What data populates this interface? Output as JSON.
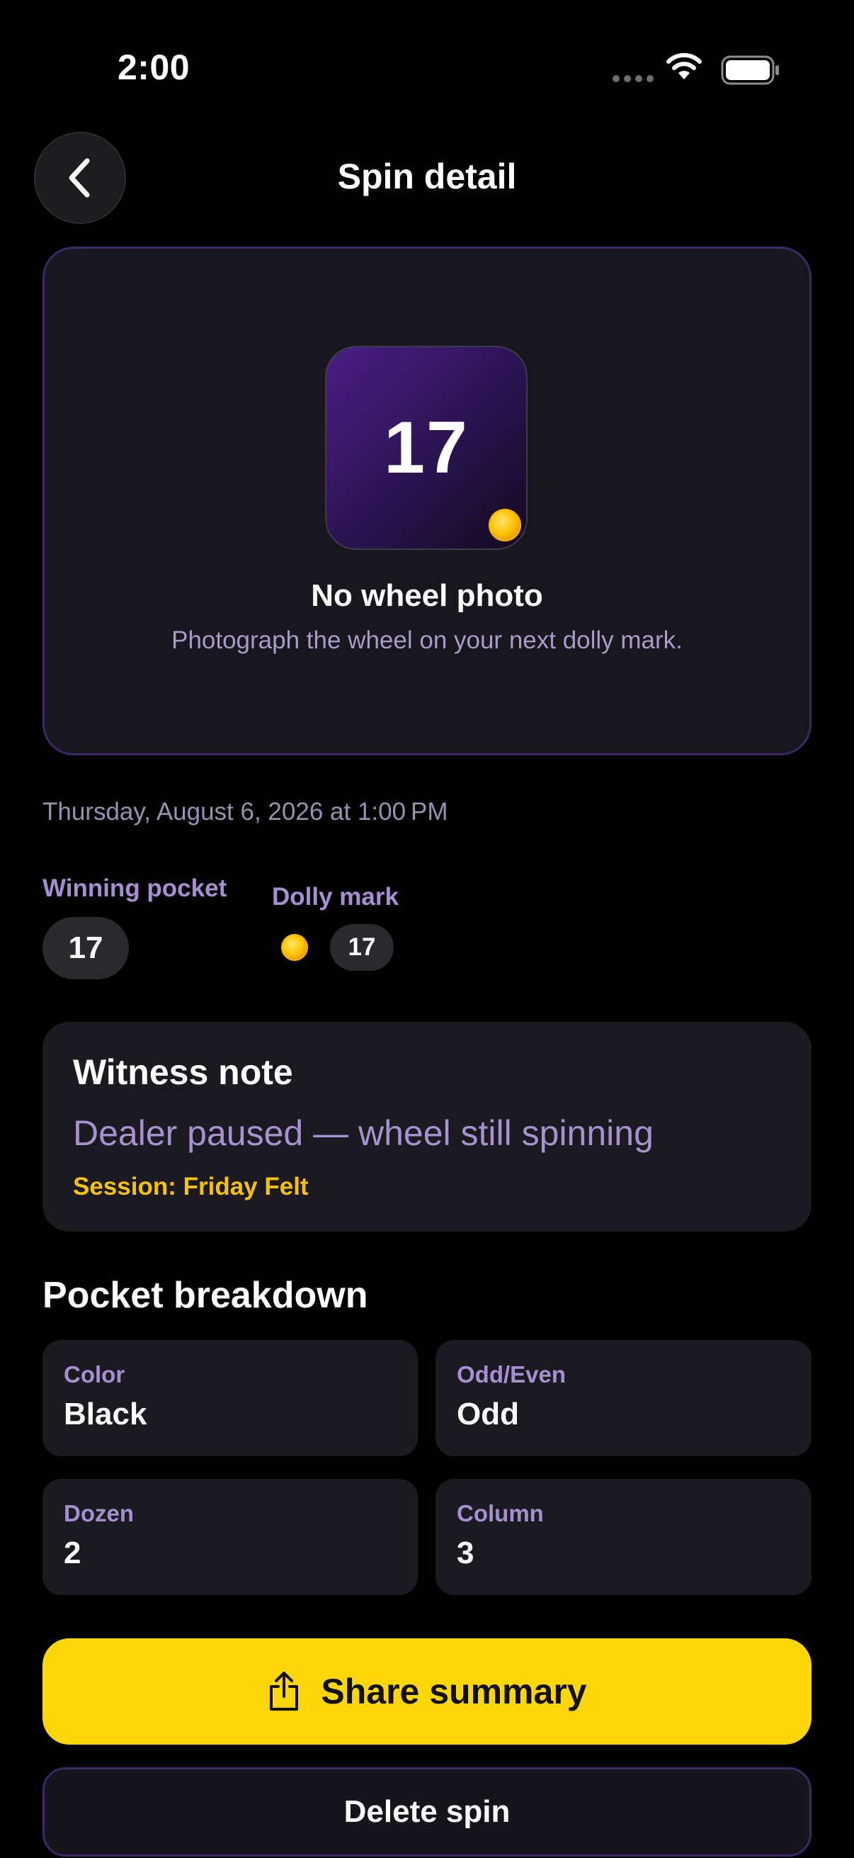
{
  "status_bar": {
    "time": "2:00"
  },
  "nav": {
    "title": "Spin detail"
  },
  "hero": {
    "number": "17",
    "title": "No wheel photo",
    "subtitle": "Photograph the wheel on your next dolly mark."
  },
  "date": "Thursday, August 6, 2026 at 1:00 PM",
  "winning_pocket": {
    "label": "Winning pocket",
    "value": "17"
  },
  "dolly_mark": {
    "label": "Dolly mark",
    "value": "17"
  },
  "witness": {
    "title": "Witness note",
    "text": "Dealer paused — wheel still spinning",
    "session": "Session: Friday Felt"
  },
  "breakdown": {
    "title": "Pocket breakdown",
    "cells": [
      {
        "label": "Color",
        "value": "Black"
      },
      {
        "label": "Odd/Even",
        "value": "Odd"
      },
      {
        "label": "Dozen",
        "value": "2"
      },
      {
        "label": "Column",
        "value": "3"
      }
    ]
  },
  "actions": {
    "share": "Share summary",
    "delete": "Delete spin"
  },
  "colors": {
    "accent_yellow": "#ffd60a",
    "accent_purple": "#a58fd0",
    "card_border": "#3a2868",
    "session_gold": "#f4c20d"
  },
  "icons": [
    "wifi-icon",
    "battery-icon",
    "back-chevron-icon",
    "dolly-coin-icon",
    "share-icon"
  ]
}
